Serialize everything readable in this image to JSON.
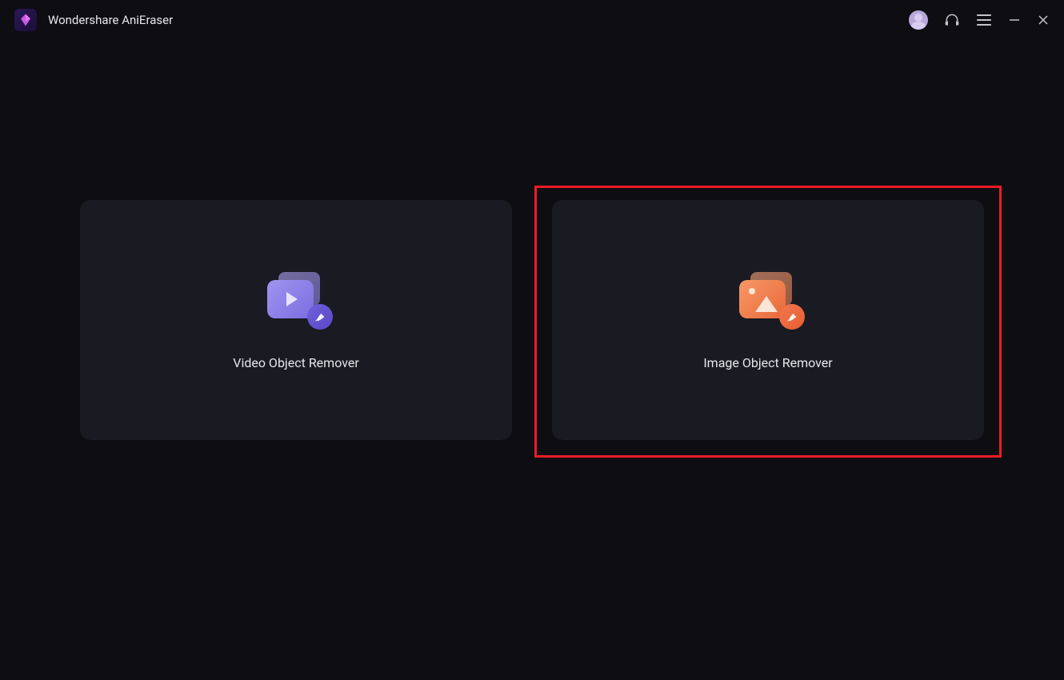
{
  "titlebar": {
    "app_name": "Wondershare AniEraser"
  },
  "cards": {
    "video": {
      "label": "Video Object Remover"
    },
    "image": {
      "label": "Image Object Remover",
      "highlighted": true
    }
  }
}
